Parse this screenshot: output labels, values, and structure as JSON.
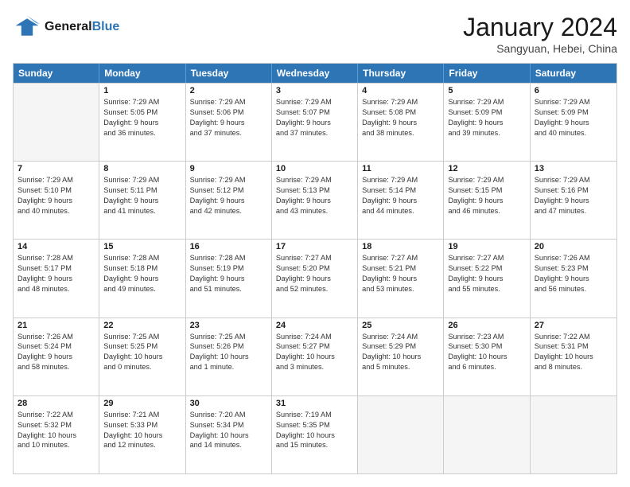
{
  "header": {
    "logo_general": "General",
    "logo_blue": "Blue",
    "month_title": "January 2024",
    "location": "Sangyuan, Hebei, China"
  },
  "days_of_week": [
    "Sunday",
    "Monday",
    "Tuesday",
    "Wednesday",
    "Thursday",
    "Friday",
    "Saturday"
  ],
  "weeks": [
    [
      {
        "day": "",
        "info": ""
      },
      {
        "day": "1",
        "info": "Sunrise: 7:29 AM\nSunset: 5:05 PM\nDaylight: 9 hours\nand 36 minutes."
      },
      {
        "day": "2",
        "info": "Sunrise: 7:29 AM\nSunset: 5:06 PM\nDaylight: 9 hours\nand 37 minutes."
      },
      {
        "day": "3",
        "info": "Sunrise: 7:29 AM\nSunset: 5:07 PM\nDaylight: 9 hours\nand 37 minutes."
      },
      {
        "day": "4",
        "info": "Sunrise: 7:29 AM\nSunset: 5:08 PM\nDaylight: 9 hours\nand 38 minutes."
      },
      {
        "day": "5",
        "info": "Sunrise: 7:29 AM\nSunset: 5:09 PM\nDaylight: 9 hours\nand 39 minutes."
      },
      {
        "day": "6",
        "info": "Sunrise: 7:29 AM\nSunset: 5:09 PM\nDaylight: 9 hours\nand 40 minutes."
      }
    ],
    [
      {
        "day": "7",
        "info": "Sunrise: 7:29 AM\nSunset: 5:10 PM\nDaylight: 9 hours\nand 40 minutes."
      },
      {
        "day": "8",
        "info": "Sunrise: 7:29 AM\nSunset: 5:11 PM\nDaylight: 9 hours\nand 41 minutes."
      },
      {
        "day": "9",
        "info": "Sunrise: 7:29 AM\nSunset: 5:12 PM\nDaylight: 9 hours\nand 42 minutes."
      },
      {
        "day": "10",
        "info": "Sunrise: 7:29 AM\nSunset: 5:13 PM\nDaylight: 9 hours\nand 43 minutes."
      },
      {
        "day": "11",
        "info": "Sunrise: 7:29 AM\nSunset: 5:14 PM\nDaylight: 9 hours\nand 44 minutes."
      },
      {
        "day": "12",
        "info": "Sunrise: 7:29 AM\nSunset: 5:15 PM\nDaylight: 9 hours\nand 46 minutes."
      },
      {
        "day": "13",
        "info": "Sunrise: 7:29 AM\nSunset: 5:16 PM\nDaylight: 9 hours\nand 47 minutes."
      }
    ],
    [
      {
        "day": "14",
        "info": "Sunrise: 7:28 AM\nSunset: 5:17 PM\nDaylight: 9 hours\nand 48 minutes."
      },
      {
        "day": "15",
        "info": "Sunrise: 7:28 AM\nSunset: 5:18 PM\nDaylight: 9 hours\nand 49 minutes."
      },
      {
        "day": "16",
        "info": "Sunrise: 7:28 AM\nSunset: 5:19 PM\nDaylight: 9 hours\nand 51 minutes."
      },
      {
        "day": "17",
        "info": "Sunrise: 7:27 AM\nSunset: 5:20 PM\nDaylight: 9 hours\nand 52 minutes."
      },
      {
        "day": "18",
        "info": "Sunrise: 7:27 AM\nSunset: 5:21 PM\nDaylight: 9 hours\nand 53 minutes."
      },
      {
        "day": "19",
        "info": "Sunrise: 7:27 AM\nSunset: 5:22 PM\nDaylight: 9 hours\nand 55 minutes."
      },
      {
        "day": "20",
        "info": "Sunrise: 7:26 AM\nSunset: 5:23 PM\nDaylight: 9 hours\nand 56 minutes."
      }
    ],
    [
      {
        "day": "21",
        "info": "Sunrise: 7:26 AM\nSunset: 5:24 PM\nDaylight: 9 hours\nand 58 minutes."
      },
      {
        "day": "22",
        "info": "Sunrise: 7:25 AM\nSunset: 5:25 PM\nDaylight: 10 hours\nand 0 minutes."
      },
      {
        "day": "23",
        "info": "Sunrise: 7:25 AM\nSunset: 5:26 PM\nDaylight: 10 hours\nand 1 minute."
      },
      {
        "day": "24",
        "info": "Sunrise: 7:24 AM\nSunset: 5:27 PM\nDaylight: 10 hours\nand 3 minutes."
      },
      {
        "day": "25",
        "info": "Sunrise: 7:24 AM\nSunset: 5:29 PM\nDaylight: 10 hours\nand 5 minutes."
      },
      {
        "day": "26",
        "info": "Sunrise: 7:23 AM\nSunset: 5:30 PM\nDaylight: 10 hours\nand 6 minutes."
      },
      {
        "day": "27",
        "info": "Sunrise: 7:22 AM\nSunset: 5:31 PM\nDaylight: 10 hours\nand 8 minutes."
      }
    ],
    [
      {
        "day": "28",
        "info": "Sunrise: 7:22 AM\nSunset: 5:32 PM\nDaylight: 10 hours\nand 10 minutes."
      },
      {
        "day": "29",
        "info": "Sunrise: 7:21 AM\nSunset: 5:33 PM\nDaylight: 10 hours\nand 12 minutes."
      },
      {
        "day": "30",
        "info": "Sunrise: 7:20 AM\nSunset: 5:34 PM\nDaylight: 10 hours\nand 14 minutes."
      },
      {
        "day": "31",
        "info": "Sunrise: 7:19 AM\nSunset: 5:35 PM\nDaylight: 10 hours\nand 15 minutes."
      },
      {
        "day": "",
        "info": ""
      },
      {
        "day": "",
        "info": ""
      },
      {
        "day": "",
        "info": ""
      }
    ]
  ]
}
